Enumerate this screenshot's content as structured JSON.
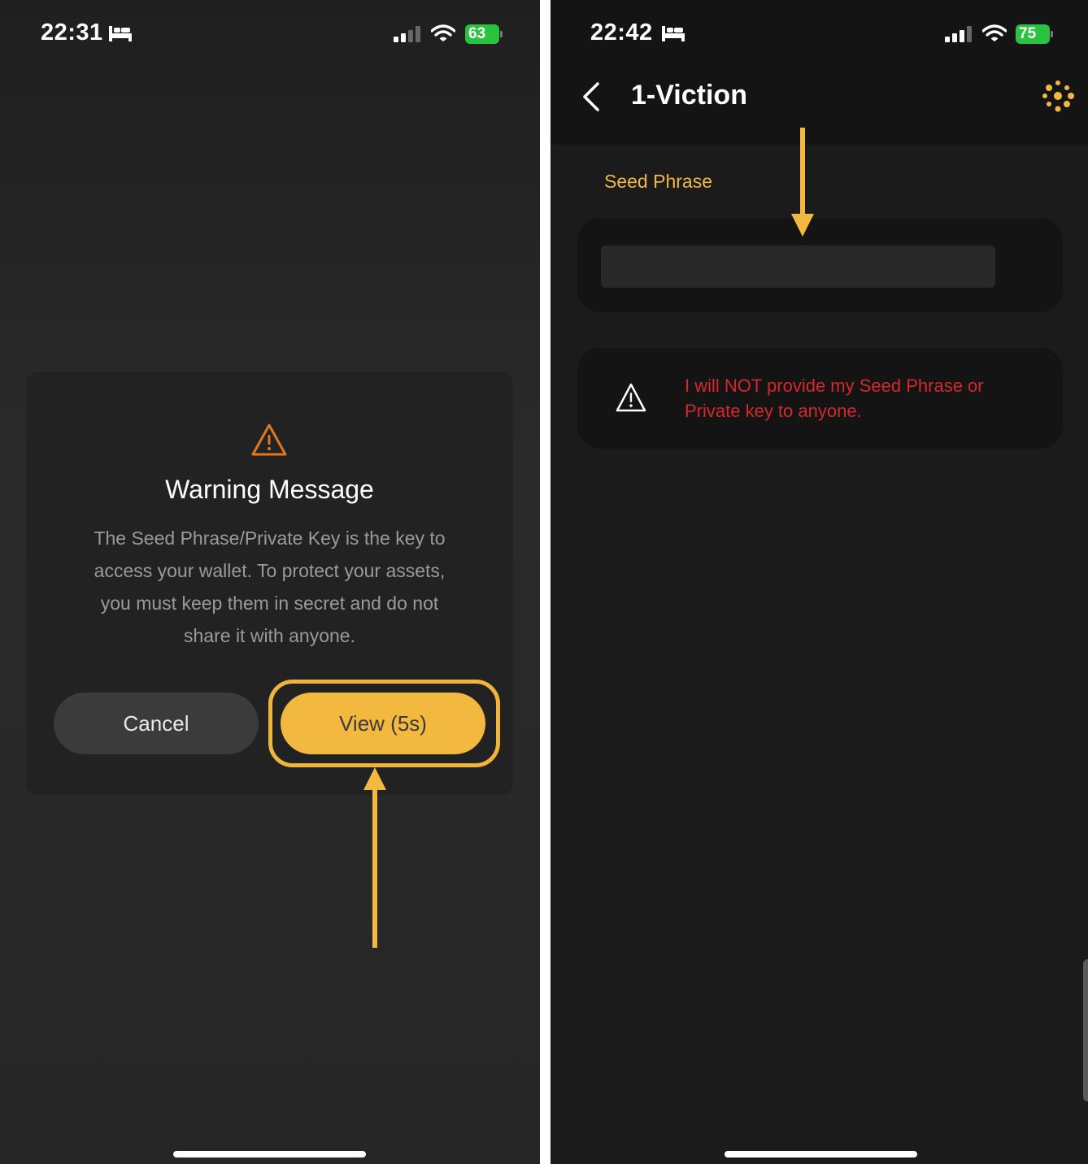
{
  "left_screen": {
    "status_bar": {
      "time": "22:31",
      "battery": "63"
    },
    "dialog": {
      "icon": "warning-triangle-icon",
      "title": "Warning Message",
      "body": "The Seed Phrase/Private Key is the key to access your wallet. To protect your assets, you must keep them in secret and do not share it with anyone.",
      "cancel_label": "Cancel",
      "view_label": "View (5s)"
    },
    "annotation": {
      "arrow": "arrow-up-icon",
      "highlight_color": "#f0b43c"
    }
  },
  "right_screen": {
    "status_bar": {
      "time": "22:42",
      "battery": "75"
    },
    "header": {
      "title": "1-Viction",
      "back_icon": "chevron-left-icon",
      "logo_icon": "viction-logo-icon"
    },
    "seed_phrase": {
      "label": "Seed Phrase",
      "value": ""
    },
    "warning": {
      "icon": "warning-triangle-icon",
      "text": "I will NOT provide my Seed Phrase or Private key to anyone."
    },
    "annotation": {
      "arrow": "arrow-down-icon"
    }
  },
  "colors": {
    "accent": "#f2b840",
    "danger": "#d5282c",
    "battery": "#2ac33f"
  }
}
